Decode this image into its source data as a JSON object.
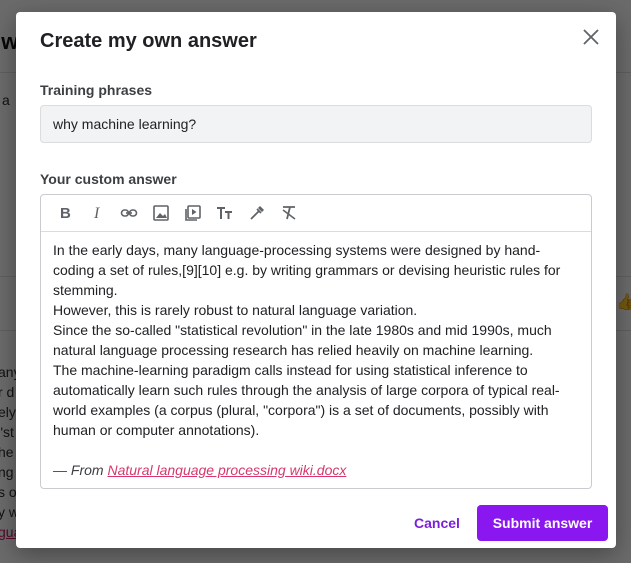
{
  "background": {
    "title_fragment": "'w",
    "text_fragment": "a",
    "line_fragments": [
      "any",
      "r d",
      "ely",
      "\"st",
      "he",
      "ng",
      "s o",
      "y w"
    ],
    "link_fragment": "gua"
  },
  "modal": {
    "title": "Create my own answer",
    "training": {
      "label": "Training phrases",
      "value": "why machine learning?"
    },
    "answer": {
      "label": "Your custom answer",
      "toolbar": [
        {
          "name": "bold-icon"
        },
        {
          "name": "italic-icon"
        },
        {
          "name": "link-icon"
        },
        {
          "name": "image-icon"
        },
        {
          "name": "video-icon"
        },
        {
          "name": "text-size-icon"
        },
        {
          "name": "eyedropper-icon"
        },
        {
          "name": "clear-format-icon"
        }
      ],
      "paragraphs": [
        "In the early days, many language-processing systems were designed by hand-coding a set of rules,[9][10] e.g. by writing grammars or devising heuristic rules for stemming.",
        "However, this is rarely robust to natural language variation.",
        "Since the so-called \"statistical revolution\" in the late 1980s and mid 1990s, much natural language processing research has relied heavily on machine learning.",
        "The machine-learning paradigm calls instead for using statistical inference to automatically learn such rules through the analysis of large corpora of typical real-world examples (a corpus (plural, \"corpora\") is a set of documents, possibly with human or computer annotations)."
      ],
      "source_prefix": "— From ",
      "source_link": "Natural language processing wiki.docx"
    },
    "cancel_label": "Cancel",
    "submit_label": "Submit answer"
  },
  "colors": {
    "accent": "#8a17f0",
    "link": "#d6386e"
  }
}
